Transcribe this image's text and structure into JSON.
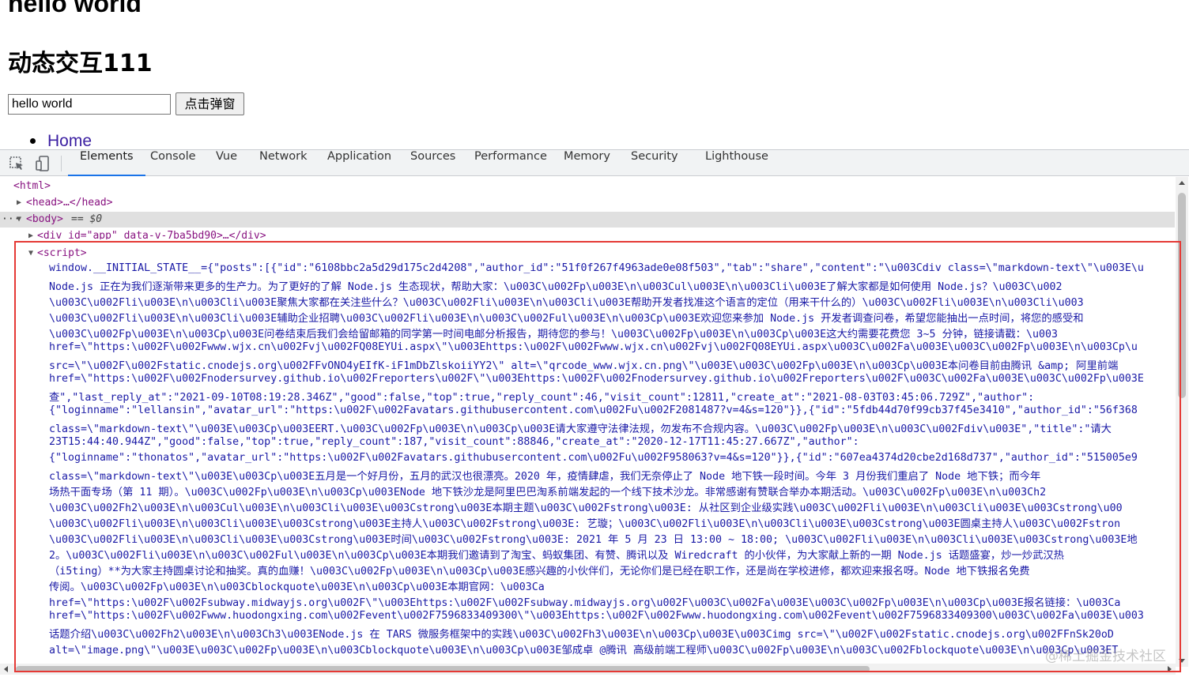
{
  "page": {
    "heading": "hello world",
    "subheading": "动态交互111",
    "input_value": "hello world",
    "button_label": "点击弹窗",
    "nav_link": "Home"
  },
  "devtools": {
    "tabs": [
      "Elements",
      "Console",
      "Vue",
      "Network",
      "Application",
      "Sources",
      "Performance",
      "Memory",
      "Security",
      "Lighthouse"
    ],
    "active_tab": "Elements",
    "tree": {
      "html_open": "<html>",
      "head": "<head>…</head>",
      "body_open": "<body>",
      "body_ref": "== $0",
      "div_app": "<div id=\"app\" data-v-7ba5bd90>…</div>",
      "script_open": "<script>"
    },
    "code_lines": [
      "window.__INITIAL_STATE__={\"posts\":[{\"id\":\"6108bbc2a5d29d175c2d4208\",\"author_id\":\"51f0f267f4963ade0e08f503\",\"tab\":\"share\",\"content\":\"\\u003Cdiv class=\\\"markdown-text\\\"\\u003E\\u",
      "Node.js 正在为我们逐渐带来更多的生产力。为了更好的了解 Node.js 生态现状，帮助大家：\\u003C\\u002Fp\\u003E\\n\\u003Cul\\u003E\\n\\u003Cli\\u003E了解大家都是如何使用 Node.js？\\u003C\\u002",
      "\\u003C\\u002Fli\\u003E\\n\\u003Cli\\u003E聚焦大家都在关注些什么？\\u003C\\u002Fli\\u003E\\n\\u003Cli\\u003E帮助开发者找准这个语言的定位（用来干什么的）\\u003C\\u002Fli\\u003E\\n\\u003Cli\\u003",
      "\\u003C\\u002Fli\\u003E\\n\\u003Cli\\u003E辅助企业招聘\\u003C\\u002Fli\\u003E\\n\\u003C\\u002Ful\\u003E\\n\\u003Cp\\u003E欢迎您来参加 Node.js 开发者调查问卷，希望您能抽出一点时间，将您的感受和",
      "\\u003C\\u002Fp\\u003E\\n\\u003Cp\\u003E问卷结束后我们会给留邮箱的同学第一时间电邮分析报告，期待您的参与！\\u003C\\u002Fp\\u003E\\n\\u003Cp\\u003E这大约需要花费您 3~5 分钟，链接请戳：\\u003",
      "href=\\\"https:\\u002F\\u002Fwww.wjx.cn\\u002Fvj\\u002FQ08EYUi.aspx\\\"\\u003Ehttps:\\u002F\\u002Fwww.wjx.cn\\u002Fvj\\u002FQ08EYUi.aspx\\u003C\\u002Fa\\u003E\\u003C\\u002Fp\\u003E\\n\\u003Cp\\u",
      "src=\\\"\\u002F\\u002Fstatic.cnodejs.org\\u002FFvONO4yEIfK-iF1mDbZlskoiiYY2\\\" alt=\\\"qrcode_www.wjx.cn.png\\\"\\u003E\\u003C\\u002Fp\\u003E\\n\\u003Cp\\u003E本问卷目前由腾讯 &amp; 阿里前端",
      "href=\\\"https:\\u002F\\u002Fnodersurvey.github.io\\u002Freporters\\u002F\\\"\\u003Ehttps:\\u002F\\u002Fnodersurvey.github.io\\u002Freporters\\u002F\\u003C\\u002Fa\\u003E\\u003C\\u002Fp\\u003E",
      "查\",\"last_reply_at\":\"2021-09-10T08:19:28.346Z\",\"good\":false,\"top\":true,\"reply_count\":46,\"visit_count\":12811,\"create_at\":\"2021-08-03T03:45:06.729Z\",\"author\":",
      "{\"loginname\":\"lellansin\",\"avatar_url\":\"https:\\u002F\\u002Favatars.githubusercontent.com\\u002Fu\\u002F2081487?v=4&s=120\"}},{\"id\":\"5fdb44d70f99cb37f45e3410\",\"author_id\":\"56f368",
      "class=\\\"markdown-text\\\"\\u003E\\u003Cp\\u003EERT.\\u003C\\u002Fp\\u003E\\n\\u003Cp\\u003E请大家遵守法律法规，勿发布不合规内容。\\u003C\\u002Fp\\u003E\\n\\u003C\\u002Fdiv\\u003E\",\"title\":\"请大",
      "23T15:44:40.944Z\",\"good\":false,\"top\":true,\"reply_count\":187,\"visit_count\":88846,\"create_at\":\"2020-12-17T11:45:27.667Z\",\"author\":",
      "{\"loginname\":\"thonatos\",\"avatar_url\":\"https:\\u002F\\u002Favatars.githubusercontent.com\\u002Fu\\u002F958063?v=4&s=120\"}},{\"id\":\"607ea4374d20cbe2d168d737\",\"author_id\":\"515005e9",
      "class=\\\"markdown-text\\\"\\u003E\\u003Cp\\u003E五月是一个好月份，五月的武汉也很漂亮。2020 年，疫情肆虐，我们无奈停止了 Node 地下铁一段时间。今年 3 月份我们重启了 Node 地下铁；而今年",
      "场热干面专场（第 11 期）。\\u003C\\u002Fp\\u003E\\n\\u003Cp\\u003ENode 地下铁沙龙是阿里巴巴淘系前端发起的一个线下技术沙龙。非常感谢有赞联合举办本期活动。\\u003C\\u002Fp\\u003E\\n\\u003Ch2",
      "\\u003C\\u002Fh2\\u003E\\n\\u003Cul\\u003E\\n\\u003Cli\\u003E\\u003Cstrong\\u003E本期主题\\u003C\\u002Fstrong\\u003E: 从社区到企业级实践\\u003C\\u002Fli\\u003E\\n\\u003Cli\\u003E\\u003Cstrong\\u00",
      "\\u003C\\u002Fli\\u003E\\n\\u003Cli\\u003E\\u003Cstrong\\u003E主持人\\u003C\\u002Fstrong\\u003E: 艺璇；\\u003C\\u002Fli\\u003E\\n\\u003Cli\\u003E\\u003Cstrong\\u003E圆桌主持人\\u003C\\u002Fstron",
      "\\u003C\\u002Fli\\u003E\\n\\u003Cli\\u003E\\u003Cstrong\\u003E时间\\u003C\\u002Fstrong\\u003E: 2021 年 5 月 23 日 13:00 ~ 18:00; \\u003C\\u002Fli\\u003E\\n\\u003Cli\\u003E\\u003Cstrong\\u003E地",
      "2。\\u003C\\u002Fli\\u003E\\n\\u003C\\u002Ful\\u003E\\n\\u003Cp\\u003E本期我们邀请到了淘宝、蚂蚁集团、有赞、腾讯以及 Wiredcraft 的小伙伴，为大家献上新的一期 Node.js 话题盛宴，炒一炒武汉热",
      "（i5ting）**为大家主持圆桌讨论和抽奖。真的血赚！\\u003C\\u002Fp\\u003E\\n\\u003Cp\\u003E感兴趣的小伙伴们，无论你们是已经在职工作，还是尚在学校进修，都欢迎来报名呀。Node 地下铁报名免费",
      "传阅。\\u003C\\u002Fp\\u003E\\n\\u003Cblockquote\\u003E\\n\\u003Cp\\u003E本期官网：\\u003Ca",
      "href=\\\"https:\\u002F\\u002Fsubway.midwayjs.org\\u002F\\\"\\u003Ehttps:\\u002F\\u002Fsubway.midwayjs.org\\u002F\\u003C\\u002Fa\\u003E\\u003C\\u002Fp\\u003E\\n\\u003Cp\\u003E报名链接：\\u003Ca",
      "href=\\\"https:\\u002F\\u002Fwww.huodongxing.com\\u002Fevent\\u002F7596833409300\\\"\\u003Ehttps:\\u002F\\u002Fwww.huodongxing.com\\u002Fevent\\u002F7596833409300\\u003C\\u002Fa\\u003E\\u003",
      "话题介绍\\u003C\\u002Fh2\\u003E\\n\\u003Ch3\\u003ENode.js 在 TARS 微服务框架中的实践\\u003C\\u002Fh3\\u003E\\n\\u003Cp\\u003E\\u003Cimg src=\\\"\\u002F\\u002Fstatic.cnodejs.org\\u002FFnSk20oD",
      "alt=\\\"image.png\\\"\\u003E\\u003C\\u002Fp\\u003E\\n\\u003Cblockquote\\u003E\\n\\u003Cp\\u003E邹成卓 @腾讯 高级前端工程师\\u003C\\u002Fp\\u003E\\n\\u003C\\u002Fblockquote\\u003E\\n\\u003Cp\\u003ET"
    ],
    "watermark": "@稀土掘金技术社区"
  }
}
